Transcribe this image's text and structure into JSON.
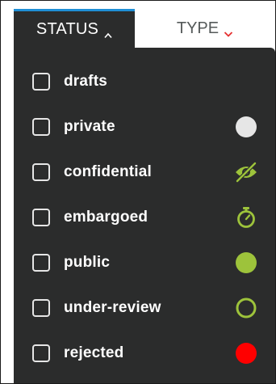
{
  "tabs": {
    "status": {
      "label": "STATUS",
      "icon": "chevron-up-icon",
      "active": true
    },
    "type": {
      "label": "TYPE",
      "icon": "chevron-down-icon",
      "active": false
    }
  },
  "colors": {
    "panel": "#2b2c2c",
    "accent_blue": "#1f8fd6",
    "green": "#9dc33b",
    "red": "#ff0000",
    "light_grey": "#e6e6e6",
    "type_chevron": "#e63030"
  },
  "status_items": [
    {
      "label": "drafts",
      "checked": false,
      "icon": ""
    },
    {
      "label": "private",
      "checked": false,
      "icon": "grey-circle-icon"
    },
    {
      "label": "confidential",
      "checked": false,
      "icon": "eye-slash-icon"
    },
    {
      "label": "embargoed",
      "checked": false,
      "icon": "stopwatch-icon"
    },
    {
      "label": "public",
      "checked": false,
      "icon": "green-circle-icon"
    },
    {
      "label": "under-review",
      "checked": false,
      "icon": "green-ring-icon"
    },
    {
      "label": "rejected",
      "checked": false,
      "icon": "red-circle-icon"
    }
  ]
}
